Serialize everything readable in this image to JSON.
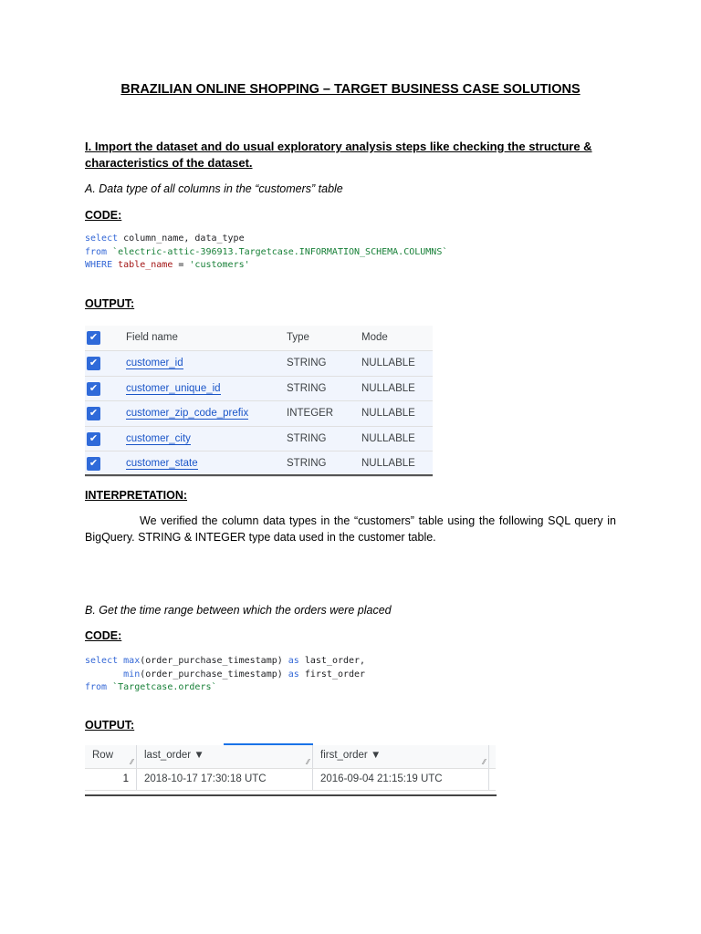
{
  "title": "BRAZILIAN ONLINE SHOPPING – TARGET BUSINESS CASE SOLUTIONS",
  "section1": {
    "heading": "I. Import the dataset and do usual exploratory analysis steps like checking the structure & characteristics of the dataset."
  },
  "partA": {
    "subtitle": "A. Data type of all columns in the “customers” table",
    "code_label": "CODE:",
    "code": [
      [
        {
          "t": "select",
          "c": "kw"
        },
        {
          "t": " column_name, data_type",
          "c": "tx"
        }
      ],
      [
        {
          "t": "from",
          "c": "kw"
        },
        {
          "t": " `electric-attic-396913.Targetcase.INFORMATION_SCHEMA.COLUMNS`",
          "c": "str"
        }
      ],
      [
        {
          "t": "WHERE",
          "c": "kw"
        },
        {
          "t": " table_name",
          "c": "col"
        },
        {
          "t": " = ",
          "c": "tx"
        },
        {
          "t": "'customers'",
          "c": "str"
        }
      ]
    ],
    "output_label": "OUTPUT:",
    "table": {
      "headers": [
        "Field name",
        "Type",
        "Mode"
      ],
      "rows": [
        [
          "customer_id",
          "STRING",
          "NULLABLE"
        ],
        [
          "customer_unique_id",
          "STRING",
          "NULLABLE"
        ],
        [
          "customer_zip_code_prefix",
          "INTEGER",
          "NULLABLE"
        ],
        [
          "customer_city",
          "STRING",
          "NULLABLE"
        ],
        [
          "customer_state",
          "STRING",
          "NULLABLE"
        ]
      ]
    },
    "interp_label": "INTERPRETATION:",
    "interpretation": "We verified the column data types in the “customers” table using the following SQL query in BigQuery.  STRING & INTEGER type data used in the customer table."
  },
  "partB": {
    "subtitle": "B. Get the time range between which the orders were placed",
    "code_label": "CODE:",
    "code": [
      [
        {
          "t": "select",
          "c": "kw"
        },
        {
          "t": " ",
          "c": "tx"
        },
        {
          "t": "max",
          "c": "fn"
        },
        {
          "t": "(order_purchase_timestamp) ",
          "c": "tx"
        },
        {
          "t": "as",
          "c": "kw"
        },
        {
          "t": " last_order,",
          "c": "tx"
        }
      ],
      [
        {
          "t": "       ",
          "c": "tx"
        },
        {
          "t": "min",
          "c": "fn"
        },
        {
          "t": "(order_purchase_timestamp) ",
          "c": "tx"
        },
        {
          "t": "as",
          "c": "kw"
        },
        {
          "t": " first_order",
          "c": "tx"
        }
      ],
      [
        {
          "t": "from",
          "c": "kw"
        },
        {
          "t": " `Targetcase.orders`",
          "c": "str"
        }
      ]
    ],
    "output_label": "OUTPUT:",
    "table": {
      "headers": [
        "Row",
        "last_order",
        "first_order"
      ],
      "rows": [
        [
          "1",
          "2018-10-17 17:30:18 UTC",
          "2016-09-04 21:15:19 UTC"
        ]
      ]
    }
  }
}
